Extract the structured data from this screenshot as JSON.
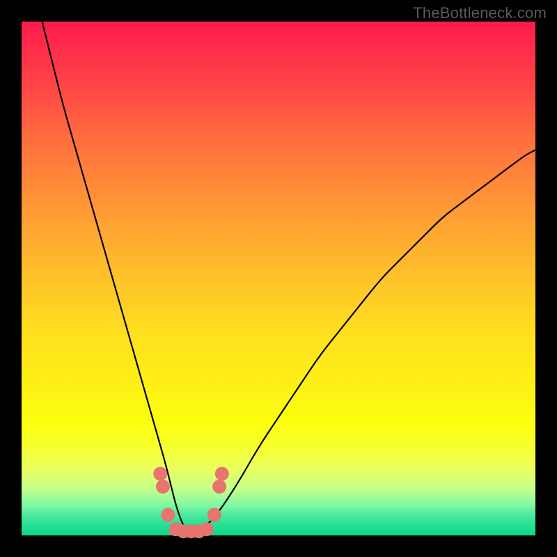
{
  "watermark": "TheBottleneck.com",
  "chart_data": {
    "type": "line",
    "title": "",
    "xlabel": "",
    "ylabel": "",
    "xlim": [
      0,
      100
    ],
    "ylim": [
      0,
      100
    ],
    "series": [
      {
        "name": "bottleneck-curve",
        "x": [
          4,
          6,
          8,
          10,
          12,
          14,
          16,
          18,
          20,
          22,
          24,
          26,
          28,
          29,
          30,
          31,
          32,
          33,
          34,
          35,
          38,
          42,
          46,
          50,
          54,
          58,
          62,
          66,
          70,
          74,
          78,
          82,
          86,
          90,
          94,
          98,
          100
        ],
        "values": [
          100,
          92,
          84,
          77,
          70,
          63,
          56,
          49,
          42,
          35,
          28,
          21,
          14,
          10,
          6,
          3,
          1,
          0.5,
          0.5,
          1,
          4,
          10,
          17,
          23,
          29,
          35,
          40,
          45,
          50,
          54,
          58,
          62,
          65,
          68,
          71,
          74,
          75
        ]
      }
    ],
    "markers": {
      "name": "critical-points",
      "color": "#e7746d",
      "points": [
        {
          "x": 27.0,
          "y": 12.0
        },
        {
          "x": 27.5,
          "y": 9.5
        },
        {
          "x": 28.5,
          "y": 4.0
        },
        {
          "x": 30.0,
          "y": 1.2
        },
        {
          "x": 31.5,
          "y": 0.8
        },
        {
          "x": 33.0,
          "y": 0.8
        },
        {
          "x": 34.5,
          "y": 0.8
        },
        {
          "x": 36.0,
          "y": 1.2
        },
        {
          "x": 37.5,
          "y": 4.0
        },
        {
          "x": 38.5,
          "y": 9.5
        },
        {
          "x": 39.0,
          "y": 12.0
        }
      ]
    },
    "gradient_bands": [
      {
        "color": "#ff1a4b",
        "stop": 0
      },
      {
        "color": "#ff8b38",
        "stop": 32
      },
      {
        "color": "#ffe21d",
        "stop": 62
      },
      {
        "color": "#fcff0e",
        "stop": 78
      },
      {
        "color": "#0dd786",
        "stop": 100
      }
    ]
  }
}
